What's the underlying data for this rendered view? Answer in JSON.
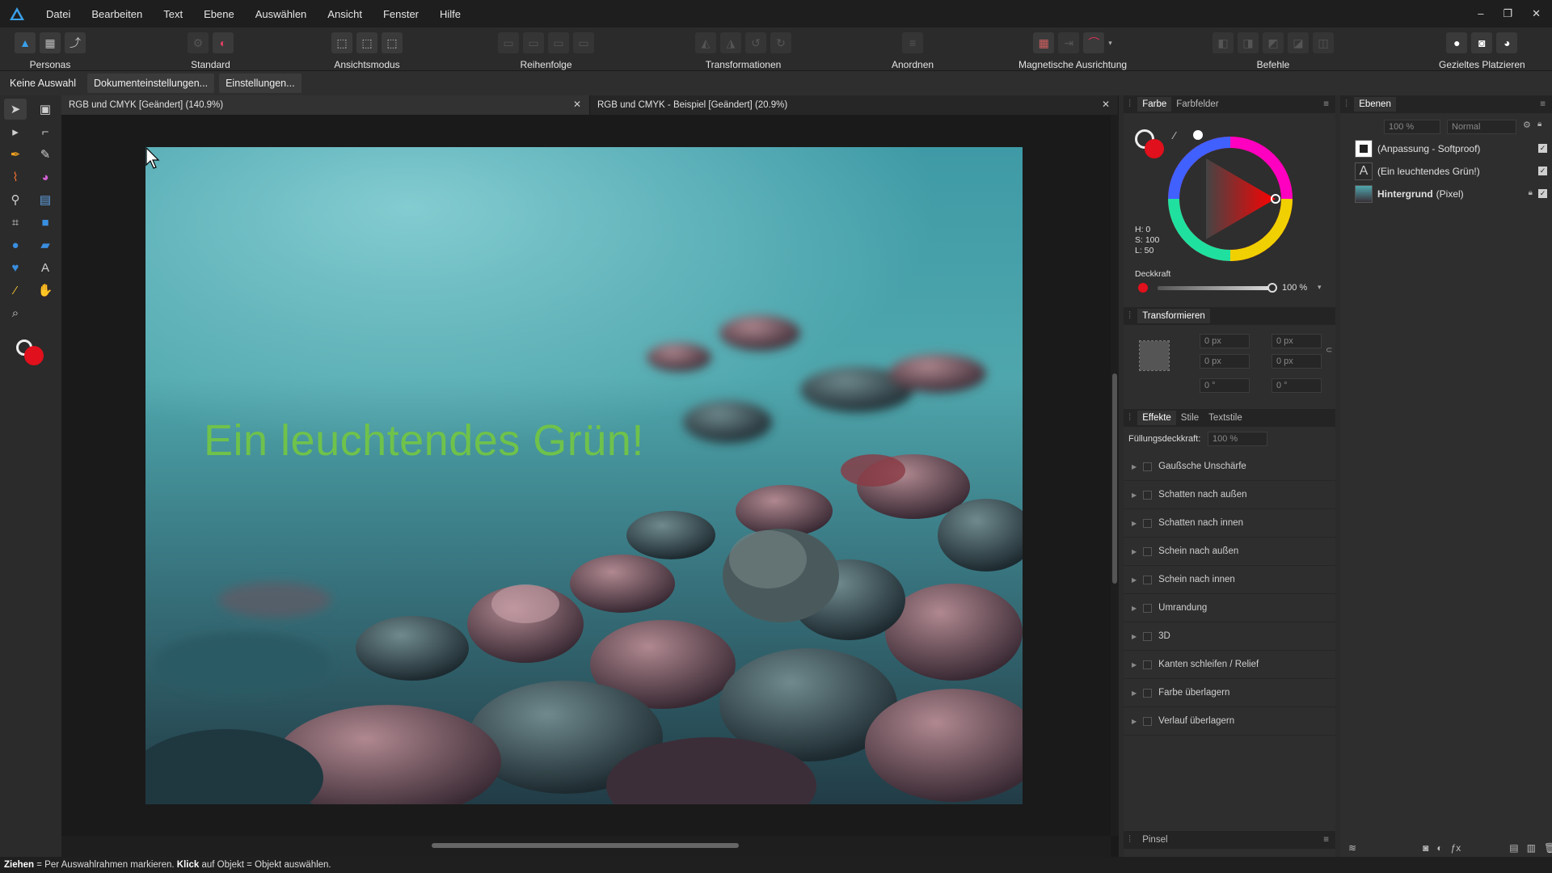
{
  "menu": [
    "Datei",
    "Bearbeiten",
    "Text",
    "Ebene",
    "Auswählen",
    "Ansicht",
    "Fenster",
    "Hilfe"
  ],
  "window_controls": [
    "–",
    "❐",
    "✕"
  ],
  "toolbar": {
    "personas": "Personas",
    "standard": "Standard",
    "ansichtsmodus": "Ansichtsmodus",
    "reihenfolge": "Reihenfolge",
    "transformationen": "Transformationen",
    "anordnen": "Anordnen",
    "magnetisch": "Magnetische Ausrichtung",
    "befehle": "Befehle",
    "gezielt": "Gezieltes Platzieren"
  },
  "context": {
    "selection": "Keine Auswahl",
    "doc_settings": "Dokumenteinstellungen...",
    "settings": "Einstellungen..."
  },
  "tabs": [
    {
      "label": "RGB und CMYK [Geändert] (140.9%)"
    },
    {
      "label": "RGB und CMYK - Beispiel [Geändert] (20.9%)"
    }
  ],
  "canvas_text": "Ein leuchtendes Grün!",
  "color_panel": {
    "tabs": [
      "Farbe",
      "Farbfelder"
    ],
    "h": "H: 0",
    "s": "S: 100",
    "l": "L: 50",
    "opacity_label": "Deckkraft",
    "opacity_value": "100 %",
    "primary_color": "#e0101c"
  },
  "transform_panel": {
    "title": "Transformieren",
    "x": "0 px",
    "y": "0 px",
    "w": "0 px",
    "h": "0 px",
    "r": "0 °",
    "s": "0 °"
  },
  "effects_panel": {
    "tabs": [
      "Effekte",
      "Stile",
      "Textstile"
    ],
    "fill_opacity_label": "Füllungsdeckkraft:",
    "fill_opacity_value": "100 %",
    "effects": [
      "Gaußsche Unschärfe",
      "Schatten nach außen",
      "Schatten nach innen",
      "Schein nach außen",
      "Schein nach innen",
      "Umrandung",
      "3D",
      "Kanten schleifen / Relief",
      "Farbe überlagern",
      "Verlauf überlagern"
    ]
  },
  "brush_panel": {
    "title": "Pinsel"
  },
  "layers_panel": {
    "title": "Ebenen",
    "opacity": "100 %",
    "blend_mode": "Normal",
    "layers": [
      {
        "name": "(Anpassung - Softproof)"
      },
      {
        "name": "(Ein leuchtendes Grün!)"
      },
      {
        "name": "Hintergrund",
        "suffix": "(Pixel)"
      }
    ]
  },
  "status": {
    "b1": "Ziehen",
    "t1": " = Per Auswahlrahmen markieren. ",
    "b2": "Klick",
    "t2": " auf Objekt = Objekt auswählen."
  }
}
